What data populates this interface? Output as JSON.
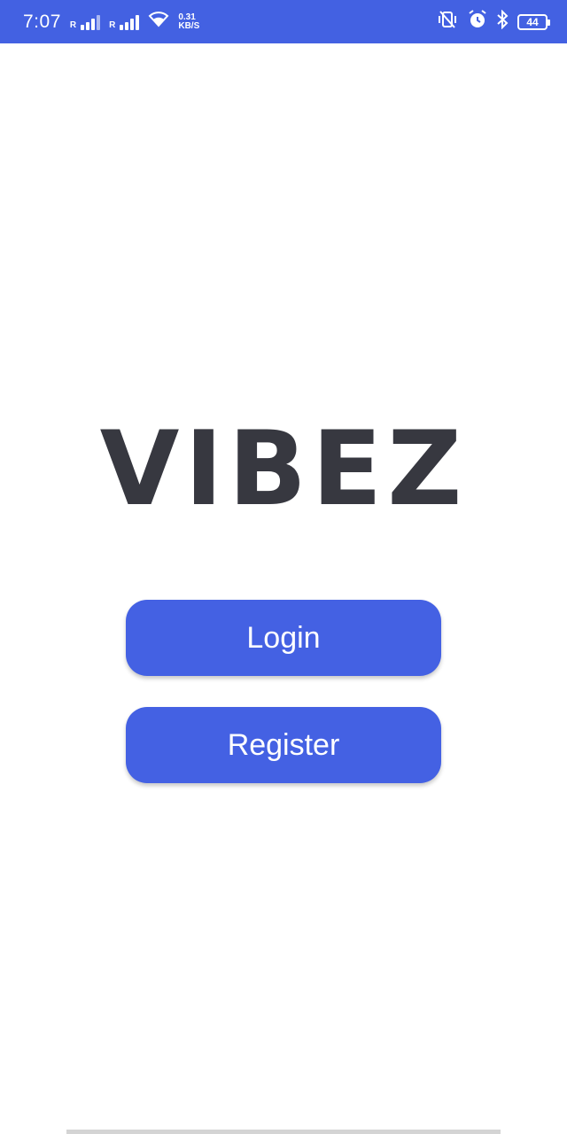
{
  "status_bar": {
    "time": "7:07",
    "signal_1_label": "R",
    "signal_2_label": "R",
    "speed_value": "0.31",
    "speed_unit": "KB/S",
    "battery_level": "44",
    "icons": [
      "vibrate-icon",
      "alarm-icon",
      "bluetooth-icon",
      "battery-icon"
    ]
  },
  "app": {
    "title": "VIBEZ",
    "accent_color": "#4361e2",
    "login_label": "Login",
    "register_label": "Register"
  }
}
